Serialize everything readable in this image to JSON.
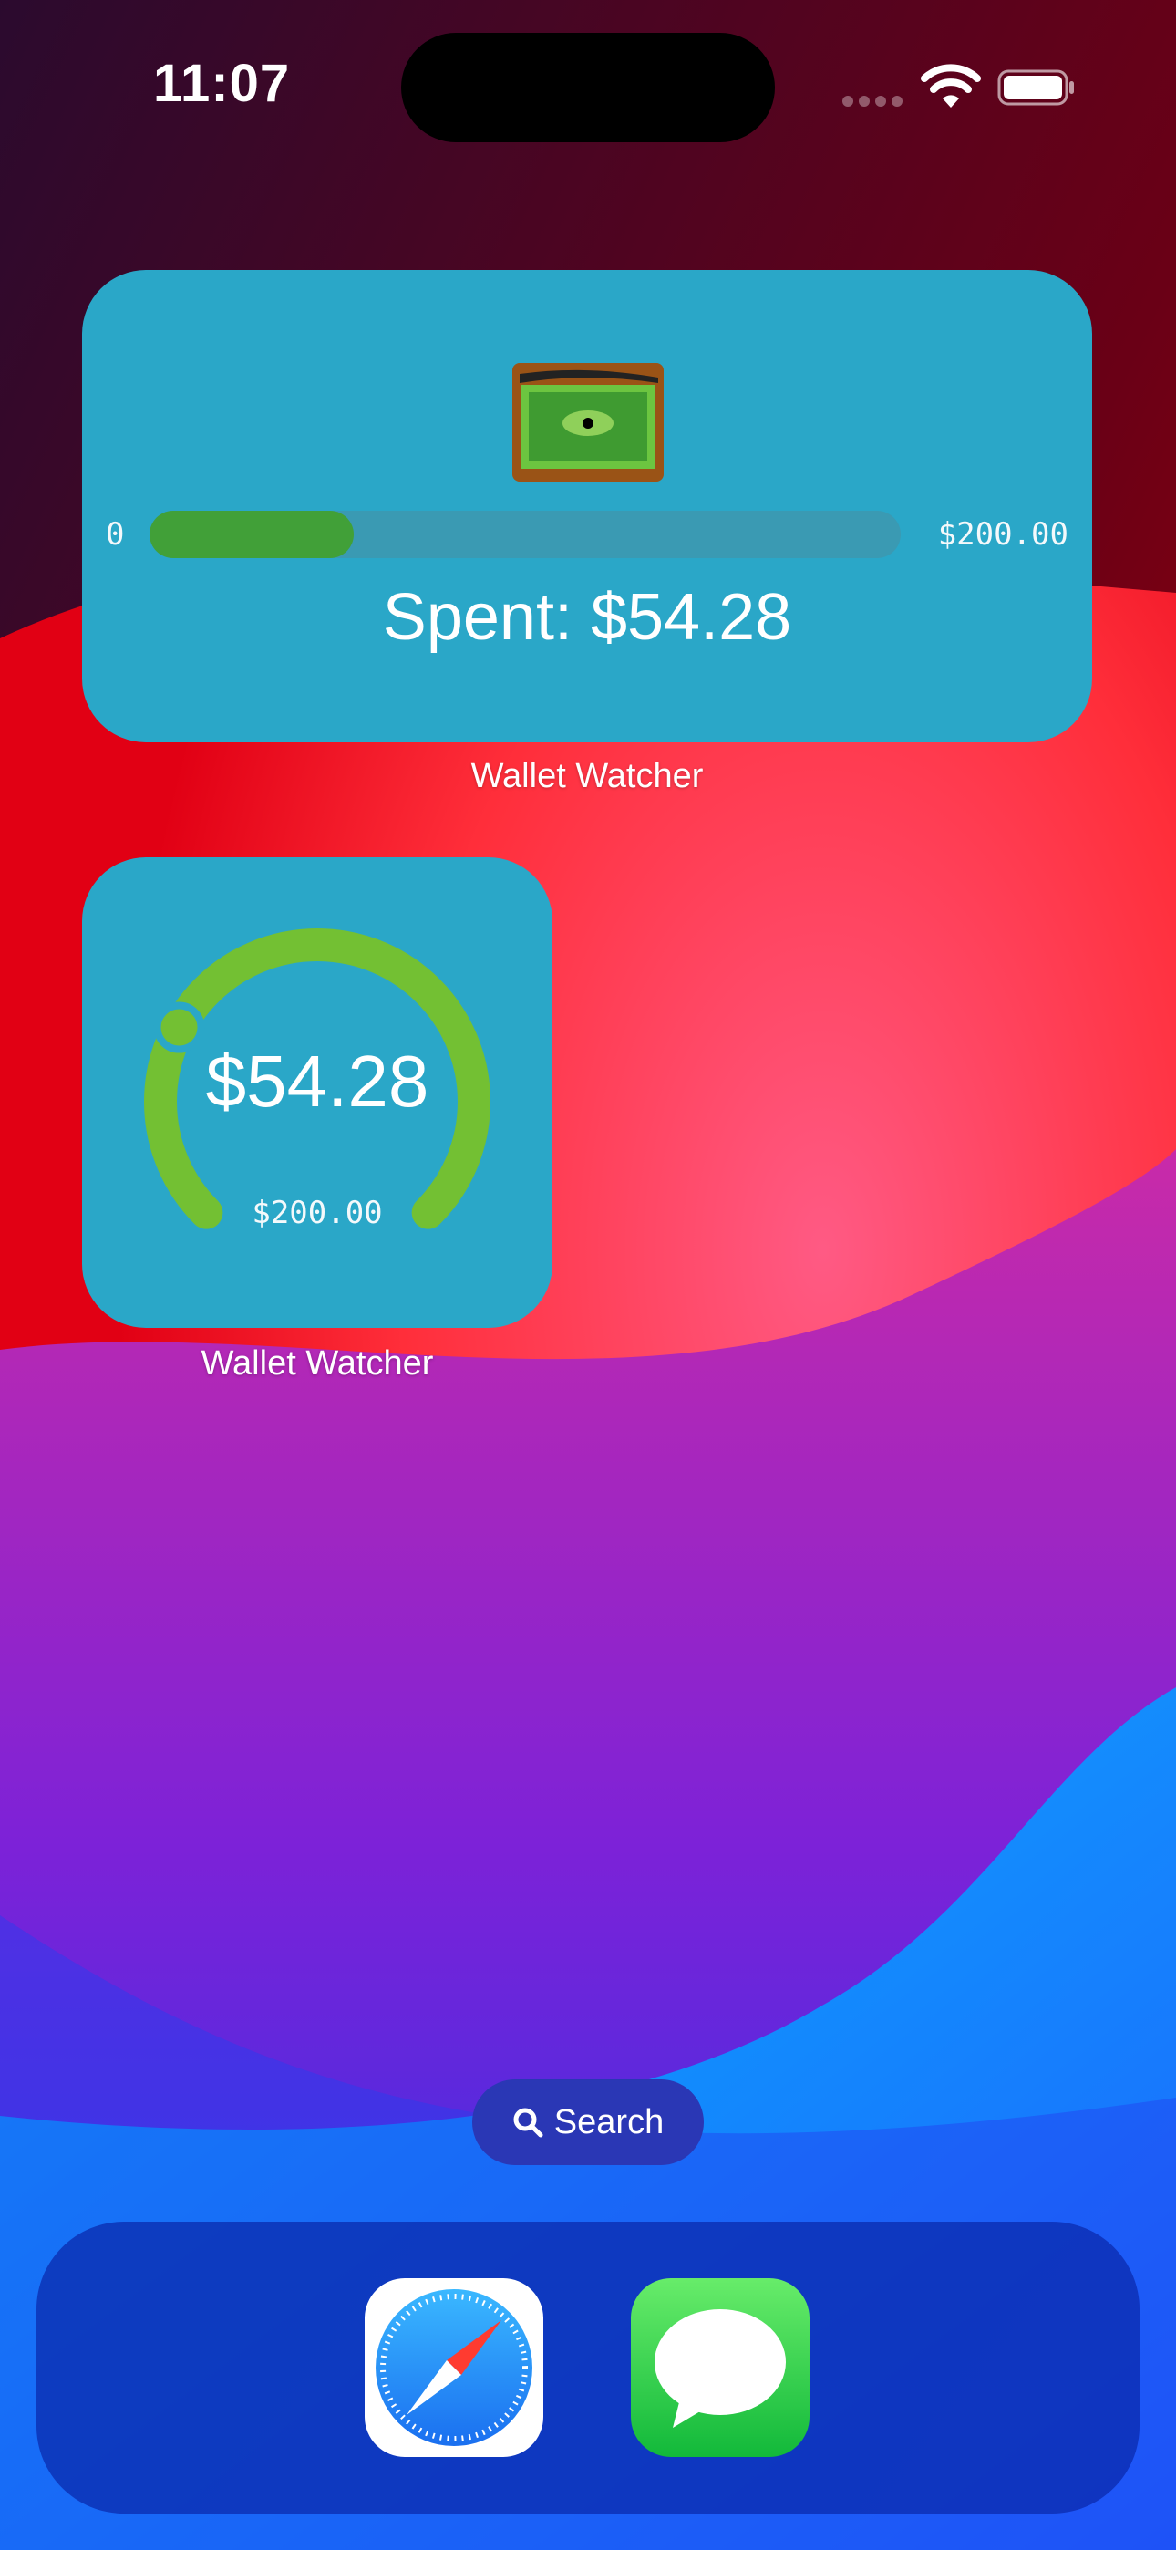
{
  "status_bar": {
    "time": "11:07"
  },
  "widgets": {
    "medium": {
      "range_min": "0",
      "range_max": "$200.00",
      "spent_text": "Spent: $54.28",
      "progress_fraction": 0.2714,
      "label": "Wallet Watcher"
    },
    "small": {
      "amount": "$54.28",
      "budget": "$200.00",
      "progress_fraction": 0.2714,
      "label": "Wallet Watcher"
    }
  },
  "search": {
    "label": "Search"
  },
  "dock": {
    "apps": [
      "safari-icon",
      "messages-icon"
    ]
  },
  "colors": {
    "widget_bg": "#2aa7c8",
    "progress_green": "#41a038",
    "gauge_green": "#73c033",
    "dock_bg": "#1a33b3"
  }
}
